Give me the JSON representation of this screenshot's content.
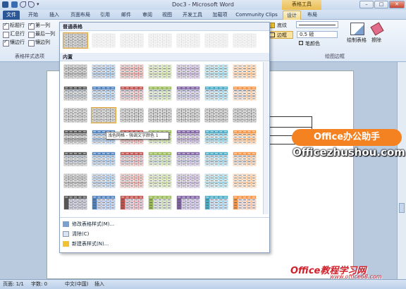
{
  "window": {
    "title": "Doc3 - Microsoft Word",
    "context_title": "表格工具"
  },
  "quick_access": [
    "save-icon",
    "undo-icon",
    "redo-icon",
    "customize-icon"
  ],
  "tabs": [
    {
      "label": "文件"
    },
    {
      "label": "开始"
    },
    {
      "label": "插入"
    },
    {
      "label": "页面布局"
    },
    {
      "label": "引用"
    },
    {
      "label": "邮件"
    },
    {
      "label": "审阅"
    },
    {
      "label": "视图"
    },
    {
      "label": "开发工具"
    },
    {
      "label": "加载项"
    },
    {
      "label": "Community Clips"
    },
    {
      "label": "设计"
    },
    {
      "label": "布局"
    }
  ],
  "ribbon": {
    "options": [
      {
        "label": "标题行",
        "checked": true
      },
      {
        "label": "第一列",
        "checked": true
      },
      {
        "label": "汇总行",
        "checked": false
      },
      {
        "label": "最后一列",
        "checked": false
      },
      {
        "label": "镶边行",
        "checked": true
      },
      {
        "label": "镶边列",
        "checked": false
      }
    ],
    "options_group": "表格样式选项",
    "shading": "底纹",
    "borders": "边框",
    "pen_weight": "0.5 磅",
    "pen_color": "笔颜色",
    "draw_table": "绘制表格",
    "eraser": "擦除",
    "borders_group": "绘图边框"
  },
  "gallery": {
    "plain_header": "普通表格",
    "builtin_header": "内置",
    "tooltip": "浅色网格 - 强调文字颜色 1",
    "menu": [
      {
        "label": "修改表格样式(M)...",
        "icon": "modify-style-icon"
      },
      {
        "label": "清除(C)",
        "icon": "clear-icon"
      },
      {
        "label": "新建表样式(N)...",
        "icon": "new-style-icon"
      }
    ],
    "colors": [
      "#555555",
      "#4f81bd",
      "#c0504d",
      "#9bbb59",
      "#8064a2",
      "#4bacc6",
      "#f79646"
    ]
  },
  "status": {
    "page": "页面: 1/1",
    "words": "字数: 0",
    "language": "中文(中国)",
    "mode": "插入"
  },
  "watermarks": {
    "top_logo": "Office办公助手",
    "top_url": "Officezhushou.com",
    "bottom_logo": "Office教程学习网",
    "bottom_url": "www.office68.com"
  }
}
